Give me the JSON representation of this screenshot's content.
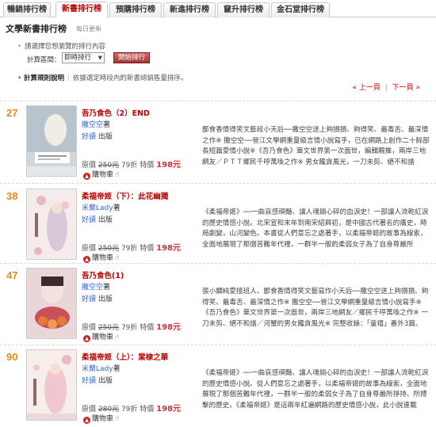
{
  "tabs": [
    {
      "label": "暢銷排行榜",
      "active": false
    },
    {
      "label": "新書排行榜",
      "active": true
    },
    {
      "label": "預購排行榜",
      "active": false
    },
    {
      "label": "新進排行榜",
      "active": false
    },
    {
      "label": "竄升排行榜",
      "active": false
    },
    {
      "label": "金石堂排行榜",
      "active": false
    }
  ],
  "header": {
    "title": "文學新書排行榜",
    "subtitle": "每日更新"
  },
  "filter": {
    "hint": "請選擇您想瀏覽的排行內容",
    "range_label": "計算區間：",
    "range_value": "即時排行",
    "button_label": "開始排行"
  },
  "rules": {
    "label": "計算規則說明",
    "desc": "依據選定時段內的新書總銷售量排序。",
    "prev": "« 上一頁",
    "separator": "|",
    "next": "下一頁 »"
  },
  "common": {
    "author_suffix": "著",
    "publisher_suffix": "出版",
    "price_label": "原價",
    "cart_label": "購物車"
  },
  "items": [
    {
      "rank": "27",
      "title": "吾乃食色（2）END",
      "author": "撒空空",
      "publisher": "好讀",
      "orig_price": "250元",
      "discount": "79折",
      "special_label": "特價",
      "special_price": "198元",
      "desc": "鄙食香情得笑文藝段小天后──撒空空送上夠損損、夠得笑、最毒舌、最深情之作※ 撒空空──晉江文學網重量級言情小說寫手，已在網路上創作二十餘部長短篇愛情小說※《吾乃食色》華文世界第一次面世，編輯親推，兩岸三地網友／ＰＴＴ鄉民千呼萬喚之作※ 男女饞貪風光，一刀未剪、絕不和諧"
    },
    {
      "rank": "38",
      "title": "柔福帝姬（下）：此花幽獨",
      "author": "米蘭Lady",
      "publisher": "好讀",
      "orig_price": "250元",
      "discount": "79折",
      "special_label": "特價",
      "special_price": "198元",
      "desc": "《柔福帝姬》──一曲哀感頑豔、讓人魂銷心碎的血淚史！一部讓人流乾紅淚的歷史情感小說。北宋宣和末年到南宋紹興初，是中國古代著名的痛史，時局劇變，山河變色。本書從人們意忘之處著手，以柔福帝姬的故事為線索，全面地展現了那個苦難年代裡，一群半一般的柔弱女子為了自身尊嚴所"
    },
    {
      "rank": "47",
      "title": "吾乃食色(1)",
      "author": "撒空空",
      "publisher": "好讀",
      "orig_price": "250元",
      "discount": "79折",
      "special_label": "特價",
      "special_price": "198元",
      "desc": "張小嫻純愛接班人、鄙食香情得笑文藝寫作小天后──撒空空送上夠損損、夠得笑、最毒舌、最深情之作※ 撒空空──晉江文學網重量級言情小說寫手※《吾乃食色》華文世界第一次面世，兩岸三地網友／鄉民千呼萬喚之作※ 一刀未剪、絕不和諧／河蟹的男女饞貪風光※ 完整收錄：「童禧」番外3篇、"
    },
    {
      "rank": "90",
      "title": "柔福帝姬（上）：棠棣之華",
      "author": "米蘭Lady",
      "publisher": "好讀",
      "orig_price": "280元",
      "discount": "79折",
      "special_label": "特價",
      "special_price": "198元",
      "desc": "《柔福帝姬》──一曲哀感頑豔、讓人魂銷心碎的血淚史！一部讓人流乾紅淚的歷史情感小說。從人們意忘之處著手，以柔福帝姬的故事為線索，全面地展現了那個苦難年代裡，一群半一般的柔弱女子為了自身尊嚴所掙持、所搏擊的歷史。《柔福帝姬》是這兩年紅遍網路的歷史情感小說，此小說連載"
    }
  ]
}
